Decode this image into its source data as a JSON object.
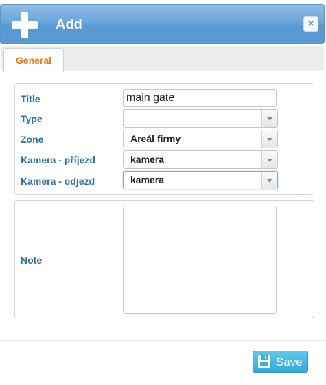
{
  "dialog": {
    "title": "Add",
    "close_label": "×",
    "icons": {
      "title": "plus-icon",
      "close": "close-icon",
      "save": "floppy-disk-icon",
      "select_arrow": "chevron-down-icon",
      "resize": "resize-grip-icon"
    },
    "colors": {
      "titlebar": "#5a9bd6",
      "label": "#2f6fa8",
      "active_tab": "#e07b17",
      "save_button": "#3bb0db"
    }
  },
  "tabs": [
    {
      "label": "General",
      "active": true
    }
  ],
  "form": {
    "title": {
      "label": "Title",
      "value": "main gate"
    },
    "type": {
      "label": "Type",
      "value": ""
    },
    "zone": {
      "label": "Zone",
      "value": "Areál firmy"
    },
    "camera_in": {
      "label": "Kamera - příjezd",
      "value": "kamera"
    },
    "camera_out": {
      "label": "Kamera - odjezd",
      "value": "kamera"
    },
    "note": {
      "label": "Note",
      "value": ""
    }
  },
  "footer": {
    "save_label": "Save"
  }
}
